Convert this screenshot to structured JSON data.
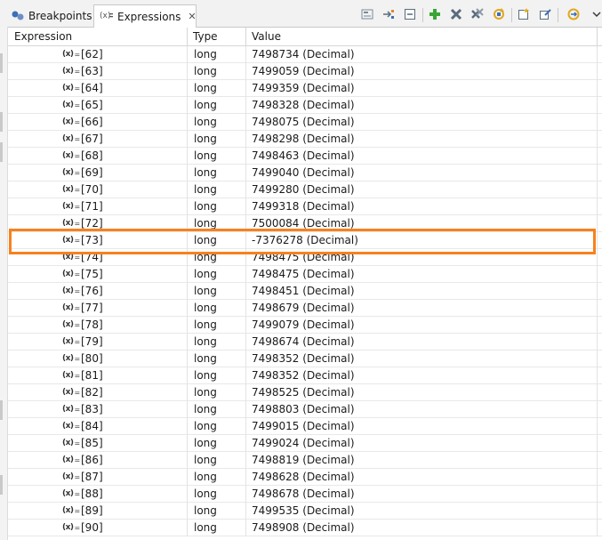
{
  "tabs": [
    {
      "label": "Breakpoints",
      "icon": "breakpoints-icon",
      "active": false
    },
    {
      "label": "Expressions",
      "icon": "expressions-icon",
      "active": true
    }
  ],
  "columns": {
    "expression": "Expression",
    "type": "Type",
    "value": "Value"
  },
  "rows": [
    {
      "expression": "[62]",
      "type": "long",
      "value": "7498734 (Decimal)"
    },
    {
      "expression": "[63]",
      "type": "long",
      "value": "7499059 (Decimal)"
    },
    {
      "expression": "[64]",
      "type": "long",
      "value": "7499359 (Decimal)"
    },
    {
      "expression": "[65]",
      "type": "long",
      "value": "7498328 (Decimal)"
    },
    {
      "expression": "[66]",
      "type": "long",
      "value": "7498075 (Decimal)"
    },
    {
      "expression": "[67]",
      "type": "long",
      "value": "7498298 (Decimal)"
    },
    {
      "expression": "[68]",
      "type": "long",
      "value": "7498463 (Decimal)"
    },
    {
      "expression": "[69]",
      "type": "long",
      "value": "7499040 (Decimal)"
    },
    {
      "expression": "[70]",
      "type": "long",
      "value": "7499280 (Decimal)"
    },
    {
      "expression": "[71]",
      "type": "long",
      "value": "7499318 (Decimal)"
    },
    {
      "expression": "[72]",
      "type": "long",
      "value": "7500084 (Decimal)"
    },
    {
      "expression": "[73]",
      "type": "long",
      "value": "-7376278 (Decimal)"
    },
    {
      "expression": "[74]",
      "type": "long",
      "value": "7498475 (Decimal)"
    },
    {
      "expression": "[75]",
      "type": "long",
      "value": "7498475 (Decimal)"
    },
    {
      "expression": "[76]",
      "type": "long",
      "value": "7498451 (Decimal)"
    },
    {
      "expression": "[77]",
      "type": "long",
      "value": "7498679 (Decimal)"
    },
    {
      "expression": "[78]",
      "type": "long",
      "value": "7499079 (Decimal)"
    },
    {
      "expression": "[79]",
      "type": "long",
      "value": "7498674 (Decimal)"
    },
    {
      "expression": "[80]",
      "type": "long",
      "value": "7498352 (Decimal)"
    },
    {
      "expression": "[81]",
      "type": "long",
      "value": "7498352 (Decimal)"
    },
    {
      "expression": "[82]",
      "type": "long",
      "value": "7498525 (Decimal)"
    },
    {
      "expression": "[83]",
      "type": "long",
      "value": "7498803 (Decimal)"
    },
    {
      "expression": "[84]",
      "type": "long",
      "value": "7499015 (Decimal)"
    },
    {
      "expression": "[85]",
      "type": "long",
      "value": "7499024 (Decimal)"
    },
    {
      "expression": "[86]",
      "type": "long",
      "value": "7498819 (Decimal)"
    },
    {
      "expression": "[87]",
      "type": "long",
      "value": "7498628 (Decimal)"
    },
    {
      "expression": "[88]",
      "type": "long",
      "value": "7498678 (Decimal)"
    },
    {
      "expression": "[89]",
      "type": "long",
      "value": "7499535 (Decimal)"
    },
    {
      "expression": "[90]",
      "type": "long",
      "value": "7498908 (Decimal)"
    }
  ],
  "highlighted_expression": "[73]",
  "colors": {
    "highlight": "#f7811f",
    "add_icon": "#3aa635",
    "remove_icon": "#5a6b7d"
  },
  "toolbar_icons": [
    "show-type-names-icon",
    "show-logical-structure-icon",
    "collapse-all-icon",
    "add-expression-icon",
    "remove-expression-icon",
    "remove-all-icon",
    "refresh-icon",
    "new-expression-icon",
    "edit-expression-icon",
    "link-with-debug-icon",
    "view-menu-icon"
  ]
}
